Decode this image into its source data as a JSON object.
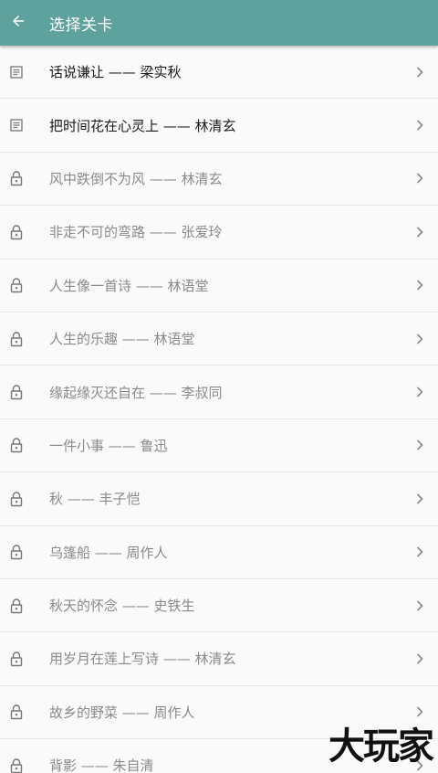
{
  "toolbar": {
    "title": "选择关卡",
    "color": "#5fa19c"
  },
  "levels": [
    {
      "label": "话说谦让 —— 梁实秋",
      "state": "unlocked",
      "icon": "document-icon"
    },
    {
      "label": "把时间花在心灵上 —— 林清玄",
      "state": "unlocked",
      "icon": "document-icon"
    },
    {
      "label": "风中跌倒不为风 —— 林清玄",
      "state": "locked",
      "icon": "lock-icon"
    },
    {
      "label": "非走不可的弯路 —— 张爱玲",
      "state": "locked",
      "icon": "lock-icon"
    },
    {
      "label": "人生像一首诗 —— 林语堂",
      "state": "locked",
      "icon": "lock-icon"
    },
    {
      "label": "人生的乐趣 —— 林语堂",
      "state": "locked",
      "icon": "lock-icon"
    },
    {
      "label": "缘起缘灭还自在 —— 李叔同",
      "state": "locked",
      "icon": "lock-icon"
    },
    {
      "label": "一件小事 —— 鲁迅",
      "state": "locked",
      "icon": "lock-icon"
    },
    {
      "label": "秋 —— 丰子恺",
      "state": "locked",
      "icon": "lock-icon"
    },
    {
      "label": "乌篷船 —— 周作人",
      "state": "locked",
      "icon": "lock-icon"
    },
    {
      "label": "秋天的怀念 —— 史铁生",
      "state": "locked",
      "icon": "lock-icon"
    },
    {
      "label": "用岁月在莲上写诗 —— 林清玄",
      "state": "locked",
      "icon": "lock-icon"
    },
    {
      "label": "故乡的野菜 —— 周作人",
      "state": "locked",
      "icon": "lock-icon"
    },
    {
      "label": "背影 —— 朱自清",
      "state": "locked",
      "icon": "lock-icon"
    }
  ],
  "watermark": "大玩家"
}
